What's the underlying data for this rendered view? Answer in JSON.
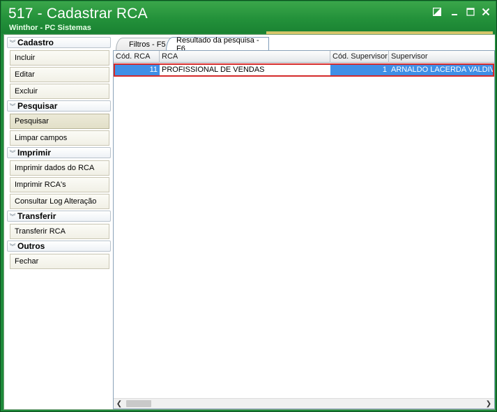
{
  "window": {
    "title": "517 - Cadastrar RCA",
    "subtitle": "Winthor - PC Sistemas"
  },
  "sidebar": {
    "groups": [
      {
        "label": "Cadastro",
        "items": [
          "Incluir",
          "Editar",
          "Excluir"
        ]
      },
      {
        "label": "Pesquisar",
        "items": [
          "Pesquisar",
          "Limpar campos"
        ]
      },
      {
        "label": "Imprimir",
        "items": [
          "Imprimir dados do RCA",
          "Imprimir RCA's",
          "Consultar Log Alteração"
        ]
      },
      {
        "label": "Transferir",
        "items": [
          "Transferir RCA"
        ]
      },
      {
        "label": "Outros",
        "items": [
          "Fechar"
        ]
      }
    ],
    "active_item": "Pesquisar"
  },
  "tabs": [
    {
      "label": "Filtros - F5",
      "active": false
    },
    {
      "label": "Resultado da pesquisa - F6",
      "active": true
    }
  ],
  "grid": {
    "columns": [
      "Cód. RCA",
      "RCA",
      "Cód. Supervisor",
      "Supervisor"
    ],
    "rows": [
      [
        "11",
        "PROFISSIONAL DE VENDAS",
        "1",
        "ARNALDO LACERDA VALDIVINO"
      ]
    ]
  },
  "colors": {
    "title_bar": "#23913a",
    "selection": "#3f8fe6",
    "highlight_border": "#d42a2a"
  }
}
